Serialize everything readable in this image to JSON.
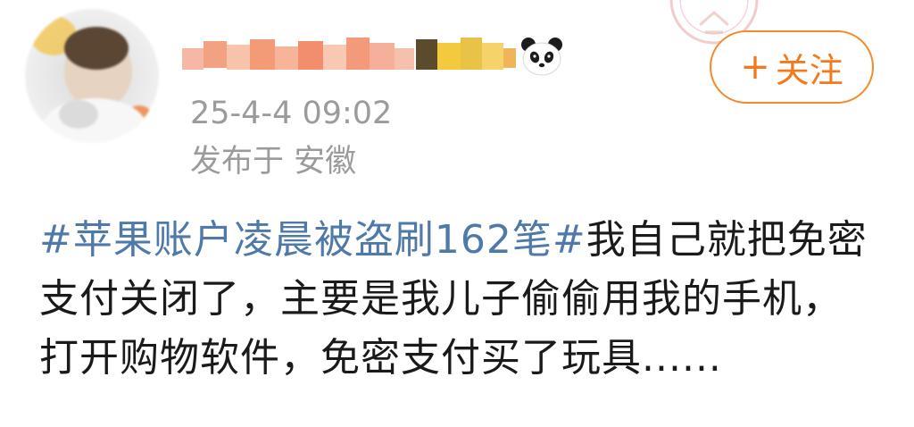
{
  "header": {
    "user_name": "",
    "timestamp": "25-4-4 09:02",
    "location": "发布于 安徽"
  },
  "follow_button": {
    "icon": "plus-icon",
    "plus_symbol": "+",
    "label": "关注"
  },
  "post": {
    "hashtag": "#苹果账户凌晨被盗刷162笔#",
    "body": "我自己就把免密支付关闭了，主要是我儿子偷偷用我的手机，打开购物软件，免密支付买了玩具......"
  },
  "icons": {
    "avatar": "avatar",
    "panda_badge": "panda-icon",
    "stamp_watermark": "stamp-watermark"
  },
  "colors": {
    "accent": "#f3791c",
    "hashtag": "#4f79a9",
    "meta_text": "#9b9b9b",
    "body_text": "#1a1a1a"
  }
}
